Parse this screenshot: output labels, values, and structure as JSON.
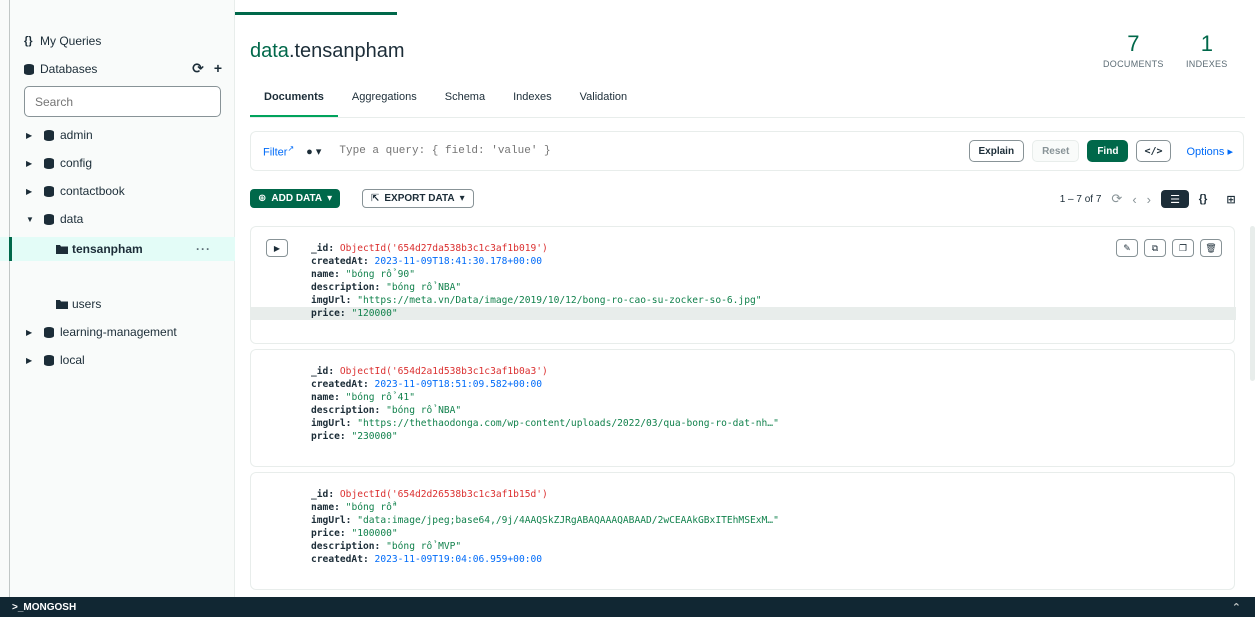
{
  "sidebar": {
    "my_queries": "My Queries",
    "databases": "Databases",
    "search_placeholder": "Search",
    "tree": [
      {
        "label": "admin"
      },
      {
        "label": "config"
      },
      {
        "label": "contactbook"
      },
      {
        "label": "data"
      },
      {
        "label": "tensanpham"
      },
      {
        "label": "users"
      },
      {
        "label": "learning-management"
      },
      {
        "label": "local"
      }
    ],
    "more": "···"
  },
  "header": {
    "db": "data",
    "collection": ".tensanpham",
    "documents_count": "7",
    "documents_label": "DOCUMENTS",
    "indexes_count": "1",
    "indexes_label": "INDEXES"
  },
  "tabs": [
    "Documents",
    "Aggregations",
    "Schema",
    "Indexes",
    "Validation"
  ],
  "filter": {
    "label": "Filter",
    "placeholder": "Type a query: { field: 'value' }",
    "explain": "Explain",
    "reset": "Reset",
    "find": "Find",
    "code": "</>",
    "options": "Options ▸"
  },
  "toolbar": {
    "add_data": "ADD DATA",
    "export_data": "EXPORT DATA",
    "range": "1 – 7 of 7"
  },
  "documents": [
    {
      "lines": [
        {
          "key": "_id",
          "value": "ObjectId('654d27da538b3c1c3af1b019')",
          "type": "oid"
        },
        {
          "key": "createdAt",
          "value": "2023-11-09T18:41:30.178+00:00",
          "type": "date"
        },
        {
          "key": "name",
          "value": "\"bóng rổ 90\"",
          "type": "str"
        },
        {
          "key": "description",
          "value": "\"bóng rổ NBA\"",
          "type": "str"
        },
        {
          "key": "imgUrl",
          "value": "\"https://meta.vn/Data/image/2019/10/12/bong-ro-cao-su-zocker-so-6.jpg\"",
          "type": "str"
        },
        {
          "key": "price",
          "value": "\"120000\"",
          "type": "str"
        }
      ]
    },
    {
      "lines": [
        {
          "key": "_id",
          "value": "ObjectId('654d2a1d538b3c1c3af1b0a3')",
          "type": "oid"
        },
        {
          "key": "createdAt",
          "value": "2023-11-09T18:51:09.582+00:00",
          "type": "date"
        },
        {
          "key": "name",
          "value": "\"bóng rổ 41\"",
          "type": "str"
        },
        {
          "key": "description",
          "value": "\"bóng rổ NBA\"",
          "type": "str"
        },
        {
          "key": "imgUrl",
          "value": "\"https://thethaodonga.com/wp-content/uploads/2022/03/qua-bong-ro-dat-nh…\"",
          "type": "str"
        },
        {
          "key": "price",
          "value": "\"230000\"",
          "type": "str"
        }
      ]
    },
    {
      "lines": [
        {
          "key": "_id",
          "value": "ObjectId('654d2d26538b3c1c3af1b15d')",
          "type": "oid"
        },
        {
          "key": "name",
          "value": "\"bóng rổ\"",
          "type": "str"
        },
        {
          "key": "imgUrl",
          "value": "\"data:image/jpeg;base64,/9j/4AAQSkZJRgABAQAAAQABAAD/2wCEAAkGBxITEhMSExM…\"",
          "type": "str"
        },
        {
          "key": "price",
          "value": "\"100000\"",
          "type": "str"
        },
        {
          "key": "description",
          "value": "\"bóng rổ MVP\"",
          "type": "str"
        },
        {
          "key": "createdAt",
          "value": "2023-11-09T19:04:06.959+00:00",
          "type": "date"
        }
      ]
    }
  ],
  "bottom": {
    "mongosh": ">_MONGOSH"
  },
  "colors": {
    "brand_green": "#00684a",
    "accent_green": "#00a35c",
    "link_blue": "#016bf8",
    "oid_red": "#db3030",
    "str_green": "#12824d"
  }
}
